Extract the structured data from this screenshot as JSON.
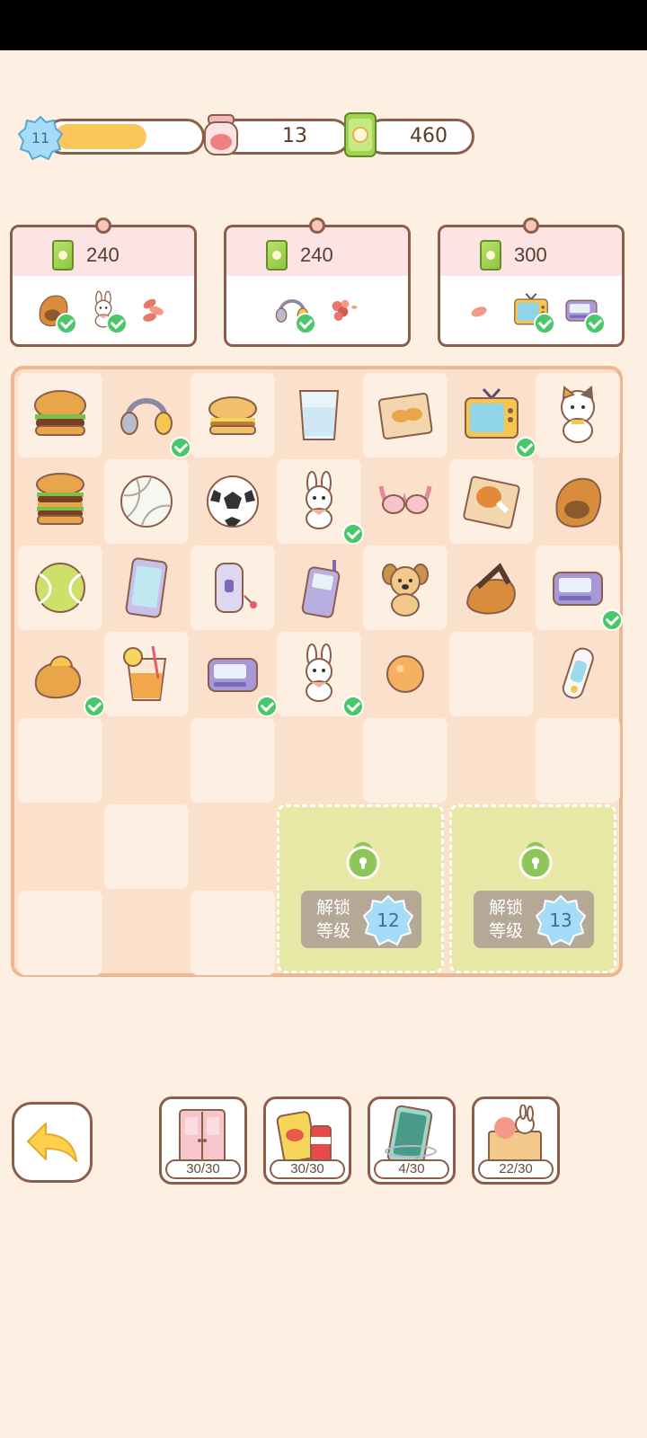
{
  "header": {
    "level": "11",
    "xp_progress": 0.68,
    "stamina": "13",
    "cash": "460"
  },
  "orders": [
    {
      "reward": "240",
      "items": [
        {
          "icon": "slipper-icon",
          "done": true
        },
        {
          "icon": "bunny-plush-icon",
          "done": true
        },
        {
          "icon": "petals-icon",
          "done": false
        }
      ]
    },
    {
      "reward": "240",
      "items": [
        {
          "icon": "headphones-icon",
          "done": true
        },
        {
          "icon": "flowers-icon",
          "done": false
        }
      ]
    },
    {
      "reward": "300",
      "items": [
        {
          "icon": "petal-icon",
          "done": false
        },
        {
          "icon": "tv-icon",
          "done": true
        },
        {
          "icon": "pager-icon",
          "done": true
        }
      ]
    }
  ],
  "board": {
    "rows": [
      [
        "burger-icon",
        "headphones-icon",
        "cheeseburger-icon",
        "glass-icon",
        "fries-box-icon",
        "tv-icon",
        "cat-plush-icon"
      ],
      [
        "double-burger-icon",
        "volleyball-icon",
        "soccer-ball-icon",
        "bunny-plush-icon",
        "bra-icon",
        "drumstick-box-icon",
        "slipper-icon"
      ],
      [
        "tennis-ball-icon",
        "smartphone-icon",
        "flip-phone-icon",
        "cell-phone-icon",
        "dog-plush-icon",
        "sandal-icon",
        "pager-icon"
      ],
      [
        "slipper-pair-icon",
        "juice-icon",
        "pager-icon",
        "bunny-plush-icon",
        "orange-ball-icon",
        "",
        "usb-drive-icon"
      ],
      [
        "",
        "",
        "",
        "",
        "",
        "",
        ""
      ],
      [
        "",
        "",
        "",
        "",
        "",
        "",
        ""
      ],
      [
        "",
        "",
        "",
        "",
        "",
        "",
        ""
      ]
    ],
    "checked": [
      [
        0,
        1
      ],
      [
        0,
        5
      ],
      [
        1,
        3
      ],
      [
        2,
        6
      ],
      [
        3,
        0
      ],
      [
        3,
        2
      ],
      [
        3,
        3
      ]
    ],
    "locked": [
      {
        "label": "解锁\n等级",
        "line1": "解锁",
        "line2": "等级",
        "level": "12"
      },
      {
        "label": "解锁\n等级",
        "line1": "解锁",
        "line2": "等级",
        "level": "13"
      }
    ]
  },
  "bottom": {
    "boxes": [
      {
        "icon": "wardrobe-icon",
        "count": "30/30"
      },
      {
        "icon": "snacks-icon",
        "count": "30/30"
      },
      {
        "icon": "phone-box-icon",
        "count": "4/30"
      },
      {
        "icon": "toy-box-icon",
        "count": "22/30"
      }
    ]
  },
  "colors": {
    "background": "#fdf0e2",
    "border": "#8b5e4a",
    "check": "#4cc66b",
    "locked_area": "#e8e8a6",
    "xp_fill": "#fbc75d"
  }
}
